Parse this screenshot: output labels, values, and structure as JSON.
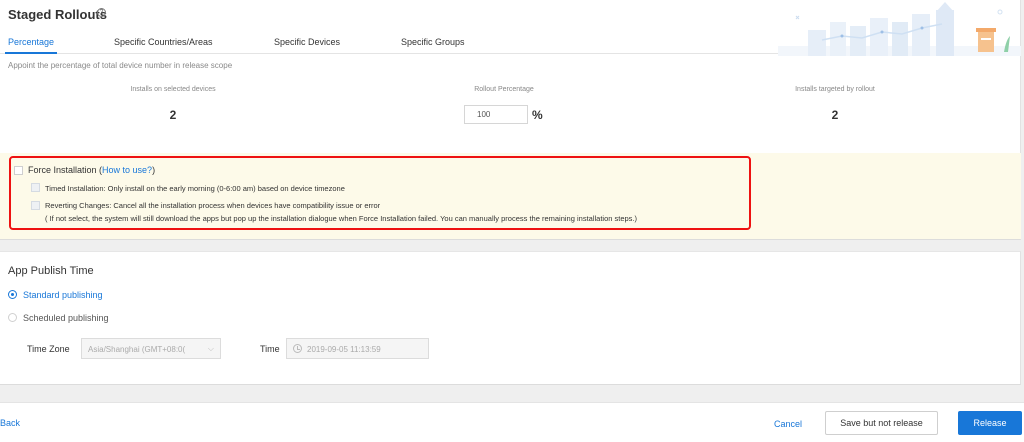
{
  "staged": {
    "title": "Staged Rollouts",
    "help_icon": "question-circle-icon",
    "tabs": [
      {
        "label": "Percentage",
        "active": true
      },
      {
        "label": "Specific Countries/Areas",
        "active": false
      },
      {
        "label": "Specific Devices",
        "active": false
      },
      {
        "label": "Specific Groups",
        "active": false
      }
    ],
    "description": "Appoint the percentage of total device number in release scope",
    "installs_selected": {
      "label": "Installs on selected devices",
      "value": "2"
    },
    "rollout_percentage": {
      "label": "Rollout Percentage",
      "value": "100",
      "unit": "%"
    },
    "installs_targeted": {
      "label": "Installs targeted by rollout",
      "value": "2"
    }
  },
  "force_install": {
    "label": "Force Installation (",
    "link": "How to use?",
    "close_paren": ")",
    "checked": false,
    "timed": {
      "label": "Timed Installation: Only install on the early morning (0-6:00 am) based on device timezone",
      "checked": false
    },
    "reverting": {
      "label": "Reverting Changes: Cancel all the installation process when devices have compatibility issue or error",
      "checked": false
    },
    "note": "( If not select, the system will still download the apps but pop up the installation dialogue when Force Installation failed. You can manually process the remaining installation steps.)"
  },
  "publish": {
    "title": "App Publish Time",
    "standard": {
      "label": "Standard publishing",
      "selected": true
    },
    "scheduled": {
      "label": "Scheduled publishing",
      "selected": false
    },
    "timezone_label": "Time Zone",
    "timezone_value": "Asia/Shanghai (GMT+08:0(",
    "time_label": "Time",
    "time_value": "2019-09-05 11:13:59"
  },
  "footer": {
    "back": "Back",
    "cancel": "Cancel",
    "save": "Save but not release",
    "release": "Release"
  },
  "colors": {
    "accent": "#1877d8",
    "banner": "#fdfae9",
    "highlight": "#ee1111"
  }
}
